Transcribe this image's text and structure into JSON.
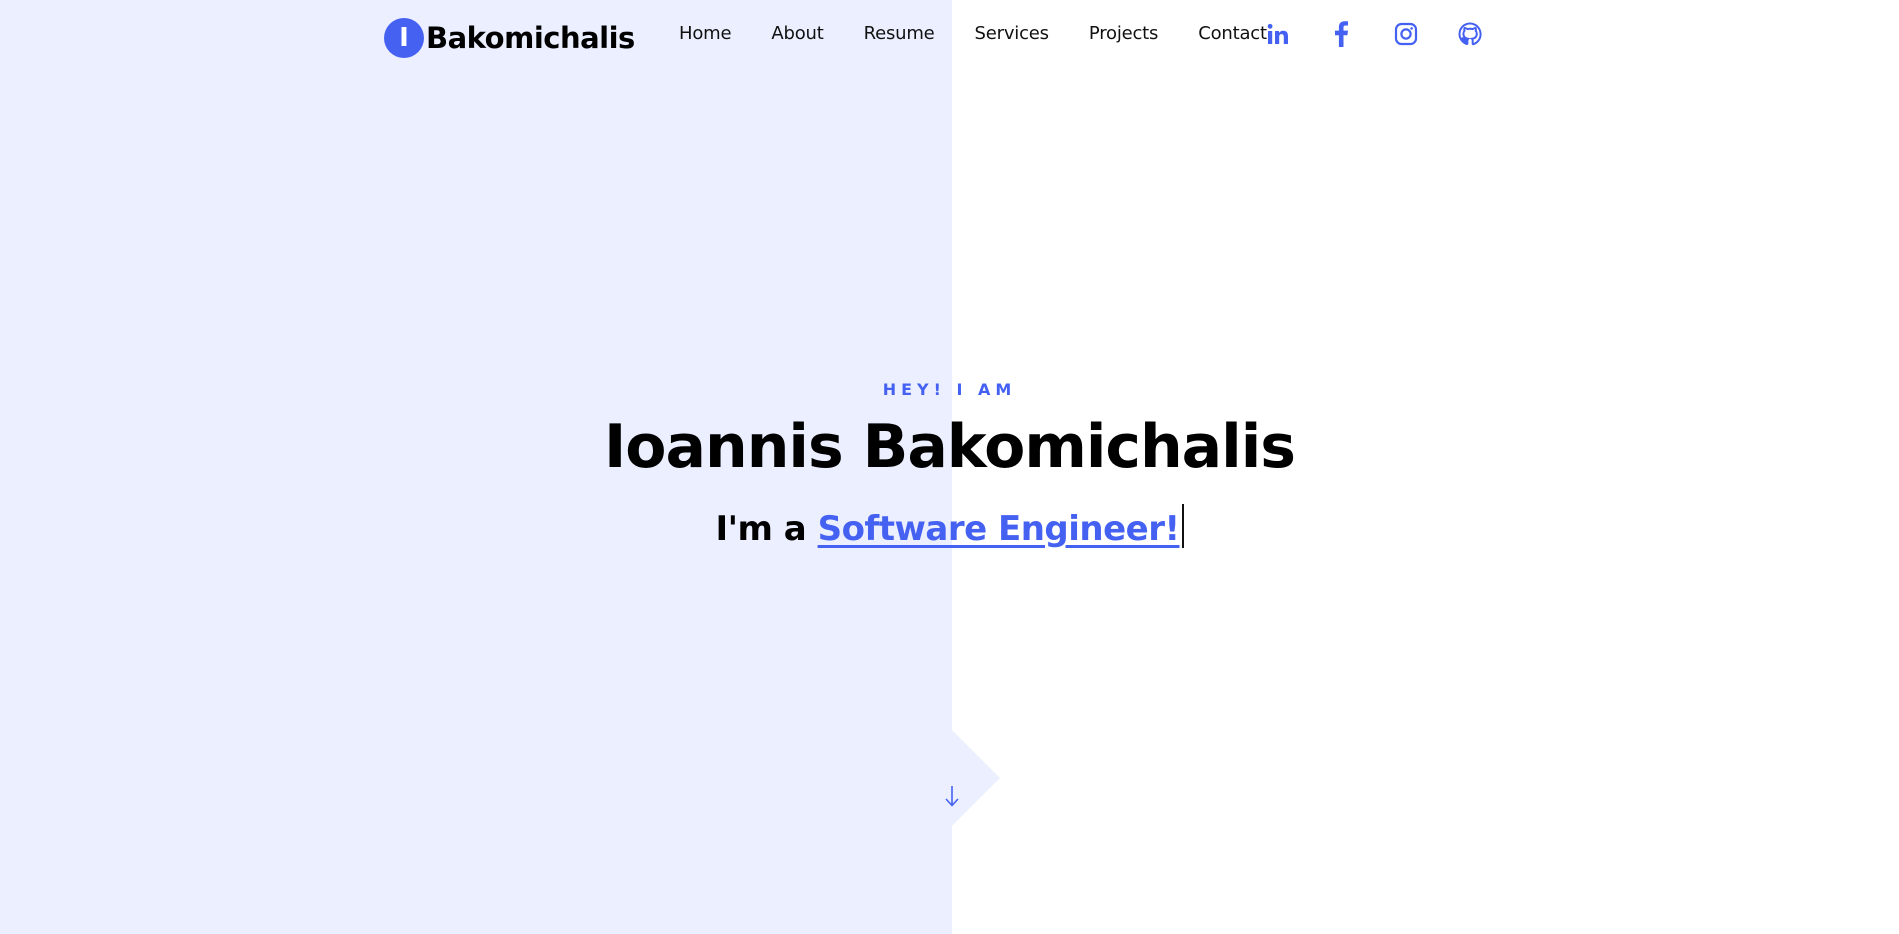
{
  "header": {
    "logo_initial": "I",
    "logo_text": "Bakomichalis",
    "nav": [
      {
        "label": "Home"
      },
      {
        "label": "About"
      },
      {
        "label": "Resume"
      },
      {
        "label": "Services"
      },
      {
        "label": "Projects"
      },
      {
        "label": "Contact"
      }
    ],
    "social": [
      {
        "icon": "linkedin-icon"
      },
      {
        "icon": "facebook-icon"
      },
      {
        "icon": "instagram-icon"
      },
      {
        "icon": "github-icon"
      }
    ]
  },
  "hero": {
    "kicker": "HEY! I AM",
    "name": "Ioannis Bakomichalis",
    "role_prefix": "I'm a ",
    "role_highlight": "Software Engineer!"
  },
  "scroll": {
    "icon": "arrow-down-icon"
  },
  "colors": {
    "accent": "#4461f2",
    "panel": "#ebefff",
    "background": "#ffffff",
    "text": "#000000"
  }
}
